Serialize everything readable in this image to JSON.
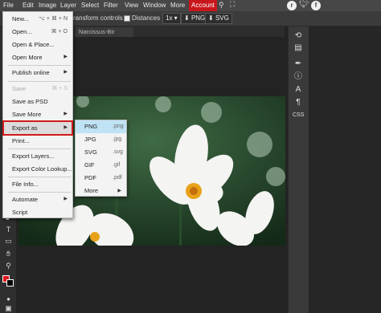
{
  "menubar": {
    "items": [
      "File",
      "Edit",
      "Image",
      "Layer",
      "Select",
      "Filter",
      "View",
      "Window",
      "More"
    ],
    "account": "Account",
    "accent_color": "#c8171c"
  },
  "options": {
    "transform_label": "ransform controls",
    "distances_label": "Distances",
    "zoom": "1x",
    "png_btn": "PNG",
    "svg_btn": "SVG"
  },
  "tabs": [
    "Narcissus-Bir"
  ],
  "file_menu": [
    {
      "label": "New...",
      "shortcut": "⌥ + ⌘ + N"
    },
    {
      "label": "Open...",
      "shortcut": "⌘ + O"
    },
    {
      "label": "Open & Place..."
    },
    {
      "label": "Open More",
      "submenu": true
    },
    {
      "label": "Publish online",
      "submenu": true
    },
    {
      "label": "Save",
      "shortcut": "⌘ + S",
      "disabled": true
    },
    {
      "label": "Save as PSD"
    },
    {
      "label": "Save More",
      "submenu": true
    },
    {
      "label": "Export as",
      "submenu": true,
      "highlighted": true
    },
    {
      "label": "Print..."
    },
    {
      "label": "Export Layers..."
    },
    {
      "label": "Export Color Lookup..."
    },
    {
      "label": "File Info..."
    },
    {
      "label": "Automate",
      "submenu": true
    },
    {
      "label": "Script"
    }
  ],
  "export_menu": [
    {
      "label": "PNG",
      "ext": ".png",
      "highlighted": true
    },
    {
      "label": "JPG",
      "ext": ".jpg"
    },
    {
      "label": "SVG",
      "ext": ".svg"
    },
    {
      "label": "GIF",
      "ext": ".gif"
    },
    {
      "label": "PDF",
      "ext": ".pdf"
    },
    {
      "label": "More",
      "submenu": true
    }
  ],
  "right_panel": {
    "css_label": "CSS"
  },
  "colors": {
    "foreground": "#e0141b",
    "background": "#000000",
    "highlight_outline": "#d11b1b",
    "submenu_highlight": "#bfe3f4"
  }
}
